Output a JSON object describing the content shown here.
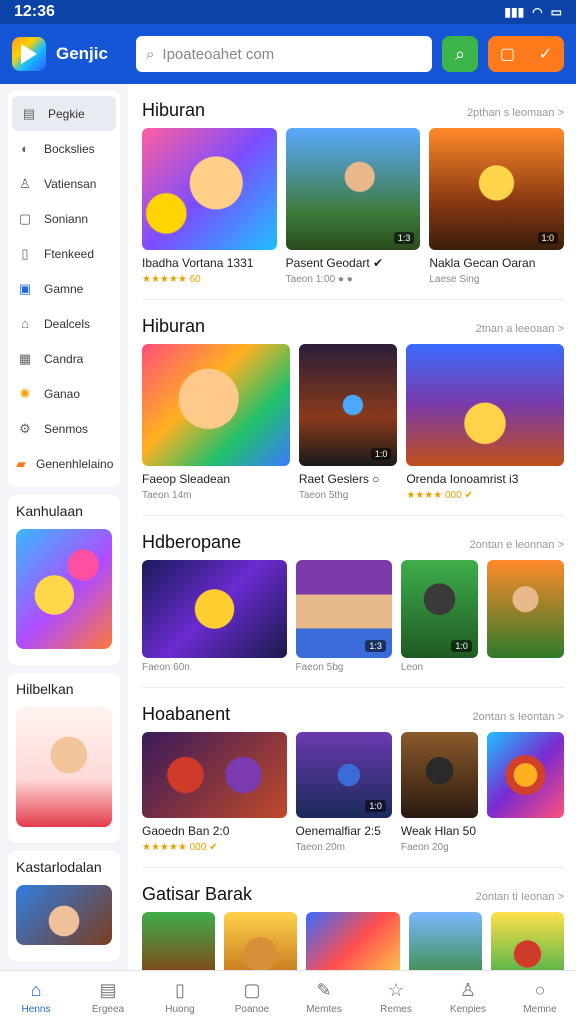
{
  "status": {
    "time": "12:36",
    "signal": "▮▮▮",
    "wifi": "◠",
    "battery": "▭"
  },
  "header": {
    "app_name": "Genjic",
    "search_placeholder": "Ipoateoahet com",
    "search_icon": "search-icon"
  },
  "sidebar": {
    "items": [
      {
        "label": "Pegkie",
        "icon": "▤"
      },
      {
        "label": "Bockslies",
        "icon": "◐"
      },
      {
        "label": "Vatiensan",
        "icon": "♙"
      },
      {
        "label": "Soniann",
        "icon": "▢"
      },
      {
        "label": "Ftenkeed",
        "icon": "▯"
      },
      {
        "label": "Gamne",
        "icon": "▣"
      },
      {
        "label": "Dealcels",
        "icon": "⌂"
      },
      {
        "label": "Candra",
        "icon": "▦"
      },
      {
        "label": "Ganao",
        "icon": "✺"
      },
      {
        "label": "Senmos",
        "icon": "⚙"
      },
      {
        "label": "Genenhlelaino",
        "icon": "▰"
      }
    ],
    "cards": [
      {
        "title": "Kanhulaan"
      },
      {
        "title": "Hilbelkan"
      },
      {
        "title": "Kastarlodalan"
      }
    ]
  },
  "sections": [
    {
      "title": "Hiburan",
      "more": "2pthan s leomaan >",
      "tiles": [
        {
          "title": "Ibadha Vortana   1331",
          "sub": "★★★★★ 60",
          "stars": true
        },
        {
          "title": "Pasent Geodart ✔",
          "sub": "Taeon 1:00 ● ●"
        },
        {
          "title": "Nakla Gecan Oaran",
          "sub": "Laese Sing"
        }
      ]
    },
    {
      "title": "Hiburan",
      "more": "2tnan a leeoaan >",
      "tiles": [
        {
          "title": "Faeop Sleadean",
          "sub": "Taeon 14m"
        },
        {
          "title": "Raet Geslers  ○",
          "sub": "Taeon 5thg"
        },
        {
          "title": "Orenda Ionoamrist i3",
          "sub": "★★★★ 000 ✔",
          "stars": true
        }
      ]
    },
    {
      "title": "Hdberopane",
      "more": "2ontan e leonnan >",
      "tiles": [
        {
          "title": "",
          "sub": "Faeon 60n"
        },
        {
          "title": "",
          "sub": "Faeon 5bg"
        },
        {
          "title": "",
          "sub": "Leon"
        },
        {
          "title": "",
          "sub": ""
        }
      ]
    },
    {
      "title": "Hoabanent",
      "more": "2ontan s Ieontan >",
      "tiles": [
        {
          "title": "Gaoedn Ban   2:0",
          "sub": "★★★★★ 000 ✔",
          "stars": true
        },
        {
          "title": "Oenemalfiar  2:5",
          "sub": "Taeon 20m"
        },
        {
          "title": "Weak Hlan 50",
          "sub": "Faeon 20g"
        },
        {
          "title": "",
          "sub": ""
        }
      ]
    },
    {
      "title": "Gatisar Barak",
      "more": "2ontan ti Ieonan >",
      "tiles": [
        {
          "title": "",
          "sub": ""
        },
        {
          "title": "",
          "sub": ""
        },
        {
          "title": "",
          "sub": ""
        },
        {
          "title": "",
          "sub": ""
        },
        {
          "title": "",
          "sub": ""
        }
      ]
    }
  ],
  "badges": {
    "a": "1:3",
    "b": "1:0",
    "c": "1:0",
    "d": "1:3",
    "e": "1:0",
    "f": "1:0"
  },
  "bottom_nav": [
    {
      "label": "Henns",
      "icon": "⌂",
      "active": true
    },
    {
      "label": "Ergeea",
      "icon": "▤"
    },
    {
      "label": "Huong",
      "icon": "▯"
    },
    {
      "label": "Poanoe",
      "icon": "▢"
    },
    {
      "label": "Memtes",
      "icon": "✎"
    },
    {
      "label": "Remes",
      "icon": "☆"
    },
    {
      "label": "Kenpies",
      "icon": "♙"
    },
    {
      "label": "Memne",
      "icon": "○"
    }
  ]
}
